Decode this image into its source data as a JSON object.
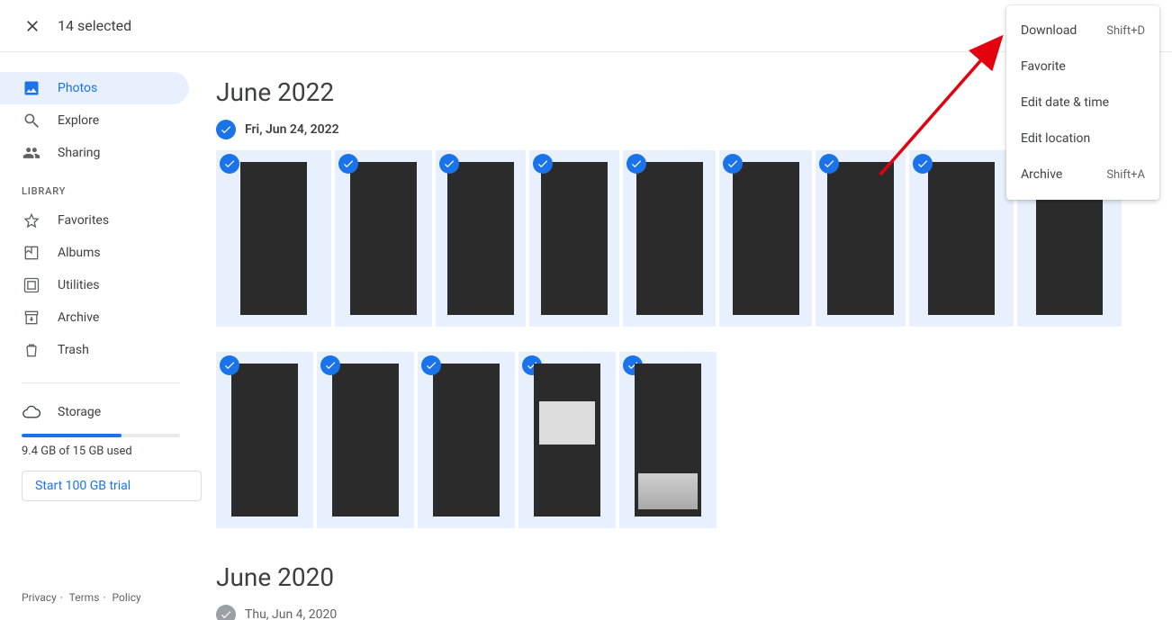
{
  "header": {
    "selected_text": "14 selected"
  },
  "sidebar": {
    "items": [
      {
        "label": "Photos"
      },
      {
        "label": "Explore"
      },
      {
        "label": "Sharing"
      }
    ],
    "library_header": "LIBRARY",
    "library": [
      {
        "label": "Favorites"
      },
      {
        "label": "Albums"
      },
      {
        "label": "Utilities"
      },
      {
        "label": "Archive"
      },
      {
        "label": "Trash"
      }
    ],
    "storage_label": "Storage",
    "storage_used": "9.4 GB of 15 GB used",
    "trial_button": "Start 100 GB trial"
  },
  "footer": {
    "privacy": "Privacy",
    "terms": "Terms",
    "policy": "Policy"
  },
  "sections": [
    {
      "title": "June 2022",
      "date": "Fri, Jun 24, 2022"
    },
    {
      "title": "June 2020",
      "date": "Thu, Jun 4, 2020"
    }
  ],
  "menu": {
    "download": "Download",
    "download_shortcut": "Shift+D",
    "favorite": "Favorite",
    "edit_date": "Edit date & time",
    "edit_location": "Edit location",
    "archive": "Archive",
    "archive_shortcut": "Shift+A"
  },
  "thumbs": {
    "count_row1": 9,
    "count_row2": 5,
    "widths_row1": [
      128,
      108,
      100,
      100,
      103,
      103,
      100,
      116,
      116
    ],
    "widths_row2": [
      108,
      108,
      108,
      108,
      108
    ]
  }
}
